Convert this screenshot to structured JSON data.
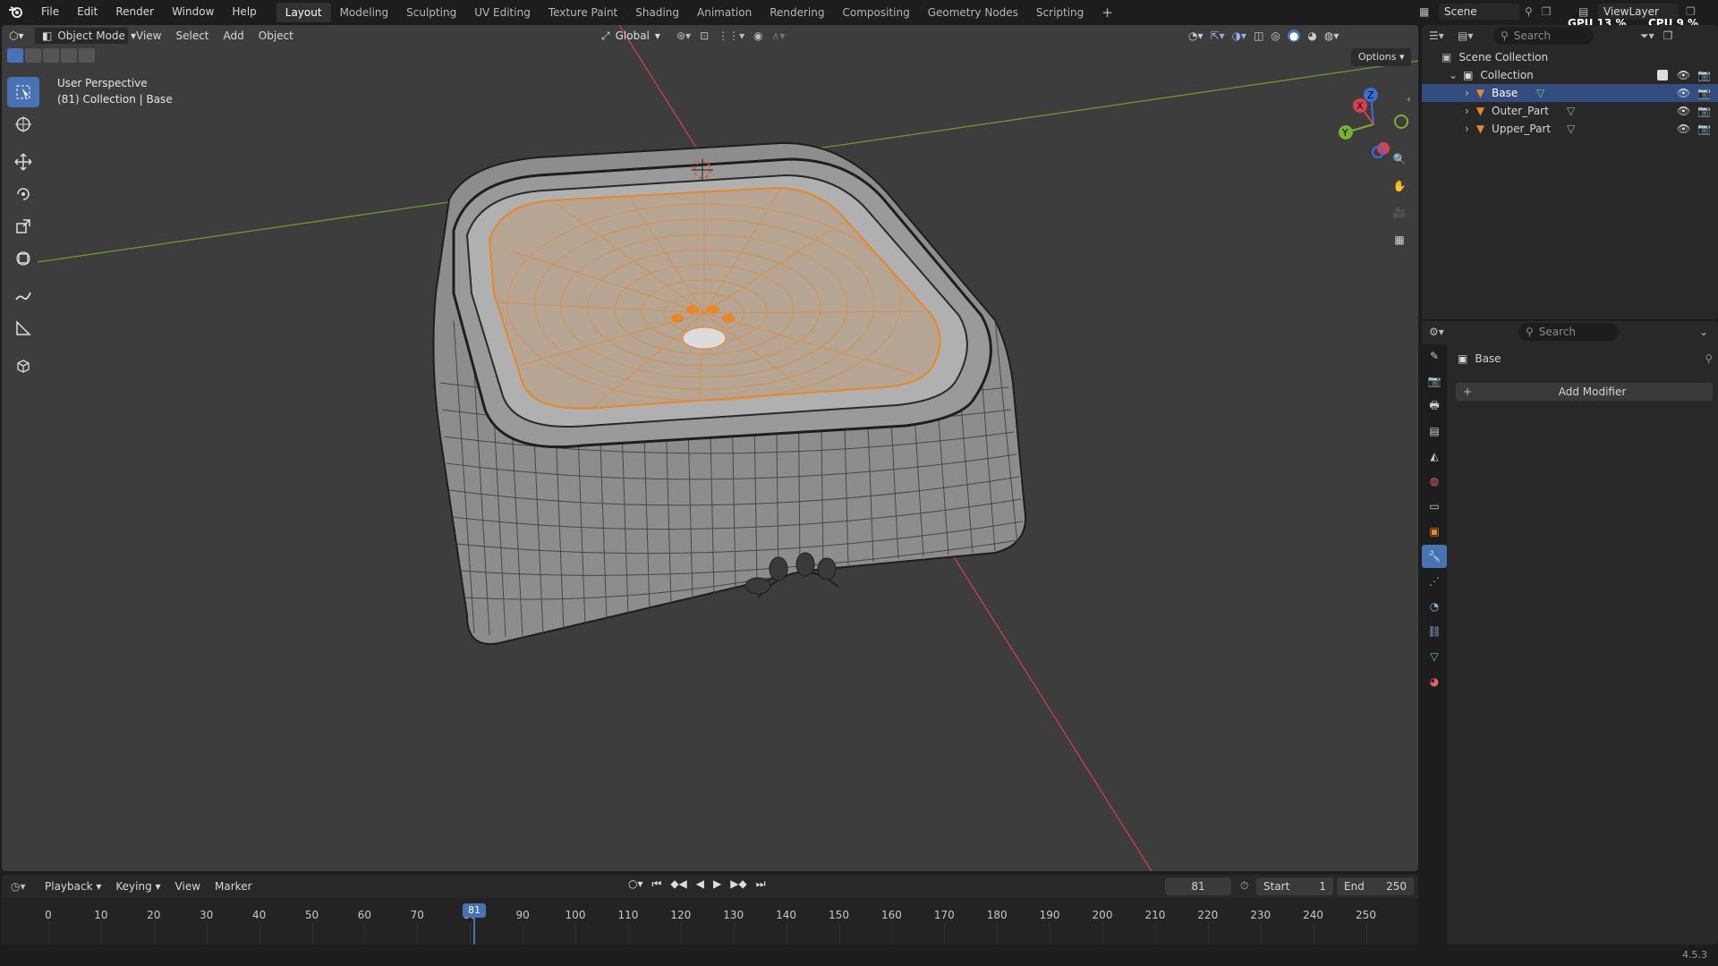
{
  "menu": {
    "items": [
      "File",
      "Edit",
      "Render",
      "Window",
      "Help"
    ]
  },
  "workspaces": {
    "tabs": [
      "Layout",
      "Modeling",
      "Sculpting",
      "UV Editing",
      "Texture Paint",
      "Shading",
      "Animation",
      "Rendering",
      "Compositing",
      "Geometry Nodes",
      "Scripting"
    ],
    "active": "Layout",
    "add": "+"
  },
  "topright": {
    "scene": "Scene",
    "viewlayer": "ViewLayer",
    "gpu": "GPU 13 %",
    "cpu": "CPU 9 %"
  },
  "viewport": {
    "mode": "Object Mode",
    "menus": [
      "View",
      "Select",
      "Add",
      "Object"
    ],
    "orientation": "Global",
    "options": "Options",
    "info_line1": "User Perspective",
    "info_line2": "(81) Collection | Base"
  },
  "gizmo": {
    "x": "X",
    "y": "Y",
    "z": "Z"
  },
  "outliner": {
    "search_placeholder": "Search",
    "scene_collection": "Scene Collection",
    "collection": "Collection",
    "objects": [
      {
        "name": "Base",
        "selected": true
      },
      {
        "name": "Outer_Part",
        "selected": false
      },
      {
        "name": "Upper_Part",
        "selected": false
      }
    ]
  },
  "properties": {
    "search_placeholder": "Search",
    "object_name": "Base",
    "add_modifier": "Add Modifier"
  },
  "timeline": {
    "menus": [
      "Playback",
      "Keying",
      "View",
      "Marker"
    ],
    "current_frame": "81",
    "start_label": "Start",
    "start": "1",
    "end_label": "End",
    "end": "250",
    "ticks": [
      "0",
      "10",
      "20",
      "30",
      "40",
      "50",
      "60",
      "70",
      "80",
      "90",
      "100",
      "110",
      "120",
      "130",
      "140",
      "150",
      "160",
      "170",
      "180",
      "190",
      "200",
      "210",
      "220",
      "230",
      "240",
      "250"
    ]
  },
  "status": {
    "version": "4.5.3"
  },
  "colors": {
    "accent": "#4772b3",
    "selected_row": "#334d80",
    "frame_marker": "#4772b3",
    "x_axis": "#c8404e",
    "y_axis": "#6a9b2a",
    "mesh_select": "#e8872a"
  }
}
